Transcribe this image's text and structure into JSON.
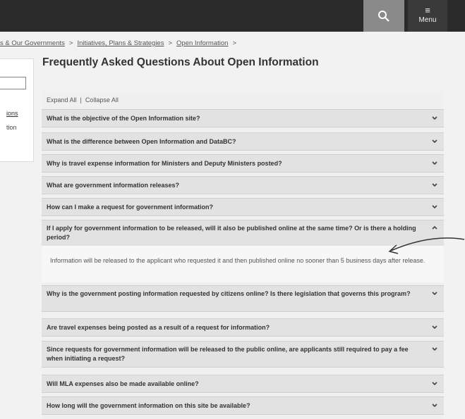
{
  "header": {
    "search_icon": "search-icon",
    "menu_icon": "menu-icon",
    "menu_label": "Menu"
  },
  "breadcrumb": {
    "items": [
      "s & Our Governments",
      "Initiatives, Plans & Strategies",
      "Open Information"
    ],
    "separator": ">"
  },
  "sidebar": {
    "item1": "ions",
    "item2": "tion"
  },
  "page": {
    "title": "Frequently Asked Questions About Open Information"
  },
  "controls": {
    "expand_all": "Expand All",
    "divider": "|",
    "collapse_all": "Collapse All"
  },
  "faqs": [
    {
      "question": "What is the objective of the Open Information site?",
      "expanded": false
    },
    {
      "question": "What is the difference between Open Information and DataBC?",
      "expanded": false
    },
    {
      "question": "Why is travel expense information for Ministers and Deputy Ministers posted?",
      "expanded": false
    },
    {
      "question": "What are government information releases?",
      "expanded": false
    },
    {
      "question": "How can I make a request for government information?",
      "expanded": false
    },
    {
      "question": "If I apply for government information to be released, will it also be published online at the same time? Or is there a holding period?",
      "expanded": true,
      "answer": "Information will be released to the applicant who requested it and then published online no sooner than 5 business days after release."
    },
    {
      "question": "Why is the government posting information requested by citizens online? Is there legislation that governs this program?",
      "expanded": false
    },
    {
      "question": "Are travel expenses being posted as a result of a request for information?",
      "expanded": false
    },
    {
      "question": "Since requests for government information will be released to the public online, are applicants still required to pay a fee when initiating a request?",
      "expanded": false
    },
    {
      "question": "Will MLA expenses also be made available online?",
      "expanded": false
    },
    {
      "question": "How long will the government information on this site be available?",
      "expanded": false
    }
  ]
}
